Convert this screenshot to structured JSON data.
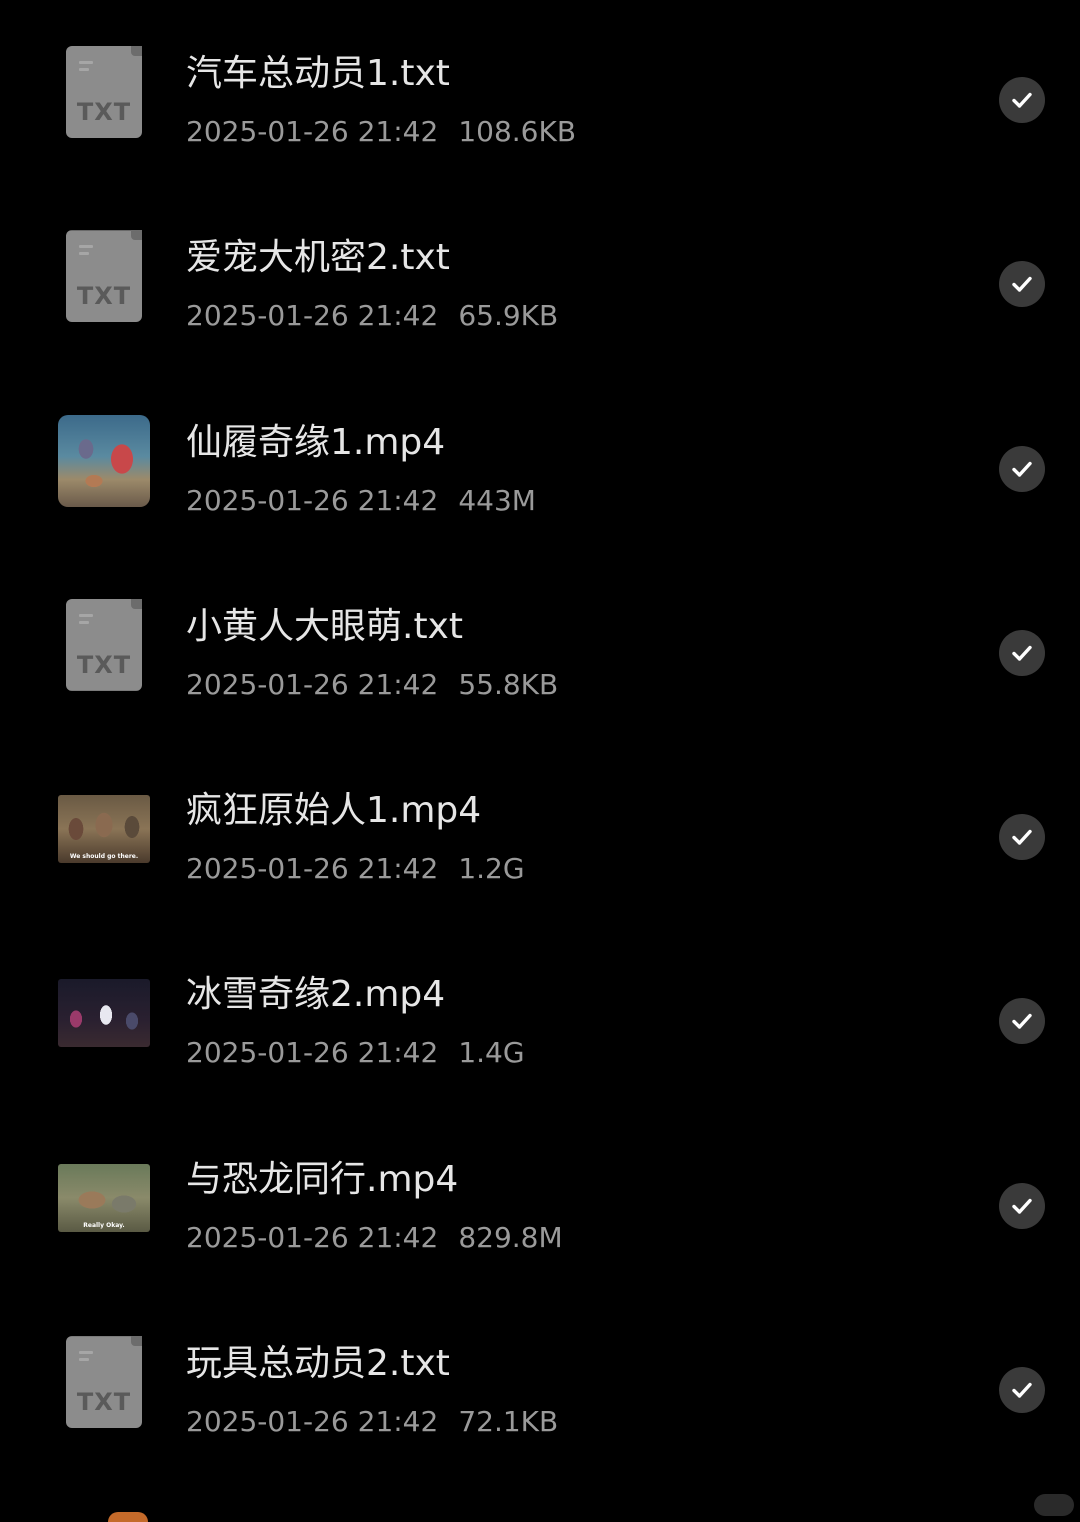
{
  "files": [
    {
      "name": "汽车总动员1.txt",
      "date": "2025-01-26 21:42",
      "size": "108.6KB",
      "type": "txt",
      "type_label": "TXT",
      "selected": true
    },
    {
      "name": "爱宠大机密2.txt",
      "date": "2025-01-26 21:42",
      "size": "65.9KB",
      "type": "txt",
      "type_label": "TXT",
      "selected": true
    },
    {
      "name": "仙履奇缘1.mp4",
      "date": "2025-01-26 21:42",
      "size": "443M",
      "type": "mp4",
      "selected": true
    },
    {
      "name": "小黄人大眼萌.txt",
      "date": "2025-01-26 21:42",
      "size": "55.8KB",
      "type": "txt",
      "type_label": "TXT",
      "selected": true
    },
    {
      "name": "疯狂原始人1.mp4",
      "date": "2025-01-26 21:42",
      "size": "1.2G",
      "type": "mp4",
      "thumb_caption": "We should go there.",
      "selected": true
    },
    {
      "name": "冰雪奇缘2.mp4",
      "date": "2025-01-26 21:42",
      "size": "1.4G",
      "type": "mp4",
      "selected": true
    },
    {
      "name": "与恐龙同行.mp4",
      "date": "2025-01-26 21:42",
      "size": "829.8M",
      "type": "mp4",
      "thumb_caption": "Really Okay.",
      "selected": true
    },
    {
      "name": "玩具总动员2.txt",
      "date": "2025-01-26 21:42",
      "size": "72.1KB",
      "type": "txt",
      "type_label": "TXT",
      "selected": true
    }
  ],
  "icons": {
    "txt_file": "txt-file-icon",
    "video_thumbnail": "video-thumbnail",
    "check": "check-circle-icon"
  },
  "colors": {
    "background": "#000000",
    "title_text": "#e6e6e6",
    "meta_text": "#9a9a9a",
    "check_bg": "#3a3a3a",
    "check_mark": "#ffffff",
    "txt_icon": "#8c8c8c"
  }
}
